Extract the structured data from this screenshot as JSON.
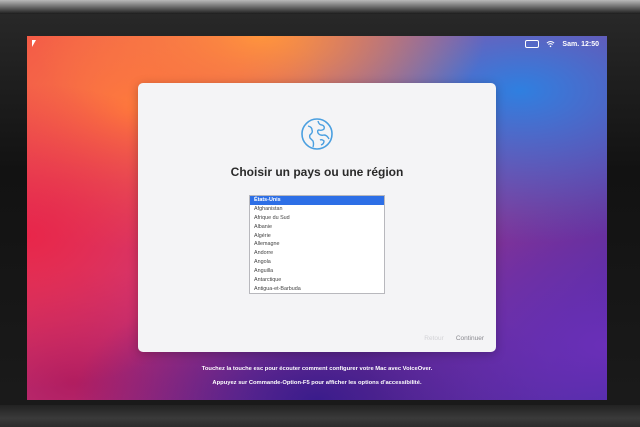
{
  "menubar": {
    "battery_label": "",
    "clock": "Sam. 12:50"
  },
  "setup": {
    "title": "Choisir un pays ou une région",
    "countries": [
      "États-Unis",
      "Afghanistan",
      "Afrique du Sud",
      "Albanie",
      "Algérie",
      "Allemagne",
      "Andorre",
      "Angola",
      "Anguilla",
      "Antarctique",
      "Antigua-et-Barbuda"
    ],
    "selected_country": "États-Unis",
    "back_label": "Retour",
    "continue_label": "Continuer"
  },
  "hints": {
    "voiceover": "Touchez la touche esc pour écouter comment configurer votre Mac avec VoiceOver.",
    "accessibility": "Appuyez sur Commande-Option-F5 pour afficher les options d'accessibilité."
  },
  "colors": {
    "selection": "#2d6fe6",
    "globe": "#4a9fe0"
  },
  "icons": [
    "cursor-icon",
    "battery-icon",
    "wifi-icon",
    "globe-icon"
  ]
}
